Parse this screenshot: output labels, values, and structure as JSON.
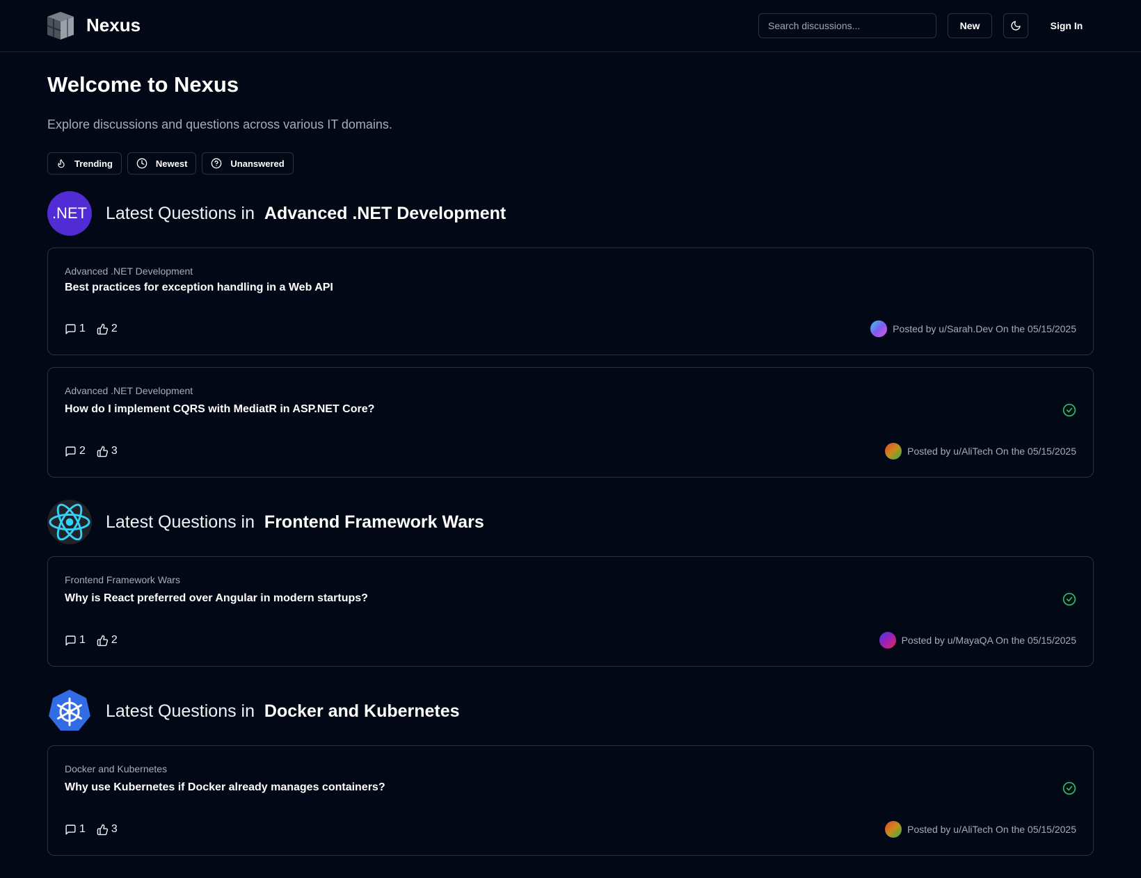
{
  "header": {
    "brand": "Nexus",
    "search_placeholder": "Search discussions...",
    "new_label": "New",
    "signin_label": "Sign In"
  },
  "hero": {
    "title": "Welcome to Nexus",
    "subtitle": "Explore discussions and questions across various IT domains.",
    "filters": [
      "Trending",
      "Newest",
      "Unanswered"
    ]
  },
  "sections": [
    {
      "prefix": "Latest Questions in",
      "name": "Advanced .NET Development",
      "icon_text": ".NET",
      "posts": [
        {
          "category": "Advanced .NET Development",
          "title": "Best practices for exception handling in a Web API",
          "comments": "1",
          "likes": "2",
          "posted": "Posted by u/Sarah.Dev On the 05/15/2025",
          "solved": false
        },
        {
          "category": "Advanced .NET Development",
          "title": "How do I implement CQRS with MediatR in ASP.NET Core?",
          "comments": "2",
          "likes": "3",
          "posted": "Posted by u/AliTech On the 05/15/2025",
          "solved": true
        }
      ]
    },
    {
      "prefix": "Latest Questions in",
      "name": "Frontend Framework Wars",
      "posts": [
        {
          "category": "Frontend Framework Wars",
          "title": "Why is React preferred over Angular in modern startups?",
          "comments": "1",
          "likes": "2",
          "posted": "Posted by u/MayaQA On the 05/15/2025",
          "solved": true
        }
      ]
    },
    {
      "prefix": "Latest Questions in",
      "name": "Docker and Kubernetes",
      "posts": [
        {
          "category": "Docker and Kubernetes",
          "title": "Why use Kubernetes if Docker already manages containers?",
          "comments": "1",
          "likes": "3",
          "posted": "Posted by u/AliTech On the 05/15/2025",
          "solved": true
        }
      ]
    }
  ]
}
